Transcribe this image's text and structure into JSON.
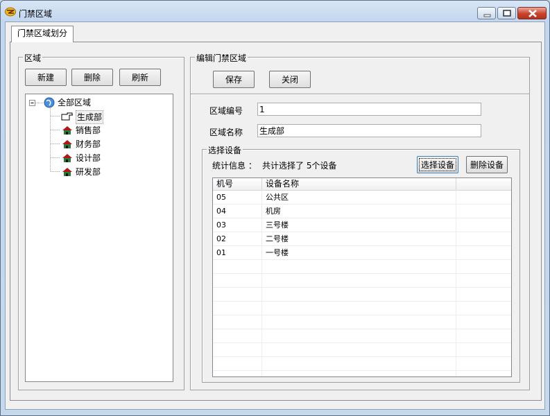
{
  "window": {
    "title": "门禁区域"
  },
  "tabs": [
    {
      "label": "门禁区域划分",
      "active": true
    }
  ],
  "region_panel": {
    "label": "区域",
    "buttons": {
      "new": "新建",
      "delete": "删除",
      "refresh": "刷新"
    },
    "tree": {
      "root": {
        "label": "全部区域",
        "icon": "globe-icon",
        "expanded": true
      },
      "children": [
        {
          "label": "生成部",
          "icon": "pointing-hand-icon",
          "selected": true
        },
        {
          "label": "销售部",
          "icon": "house-icon"
        },
        {
          "label": "财务部",
          "icon": "house-icon"
        },
        {
          "label": "设计部",
          "icon": "house-icon"
        },
        {
          "label": "研发部",
          "icon": "house-icon"
        }
      ]
    }
  },
  "edit_panel": {
    "label": "编辑门禁区域",
    "buttons": {
      "save": "保存",
      "close": "关闭"
    },
    "fields": {
      "region_id_label": "区域编号",
      "region_id_value": "1",
      "region_name_label": "区域名称",
      "region_name_value": "生成部"
    },
    "device_group": {
      "label": "选择设备",
      "stats_label": "统计信息 ：",
      "stats_text": "共计选择了 5个设备",
      "select_button": "选择设备",
      "remove_button": "删除设备",
      "columns": [
        "机号",
        "设备名称",
        ""
      ],
      "rows": [
        {
          "id": "05",
          "name": "公共区"
        },
        {
          "id": "04",
          "name": "机房"
        },
        {
          "id": "03",
          "name": "三号楼"
        },
        {
          "id": "02",
          "name": "二号楼"
        },
        {
          "id": "01",
          "name": "一号楼"
        }
      ]
    }
  },
  "colors": {
    "titlebar": "#c6d8ec",
    "close_button": "#c9432c",
    "panel_background": "#f0f0f0"
  }
}
